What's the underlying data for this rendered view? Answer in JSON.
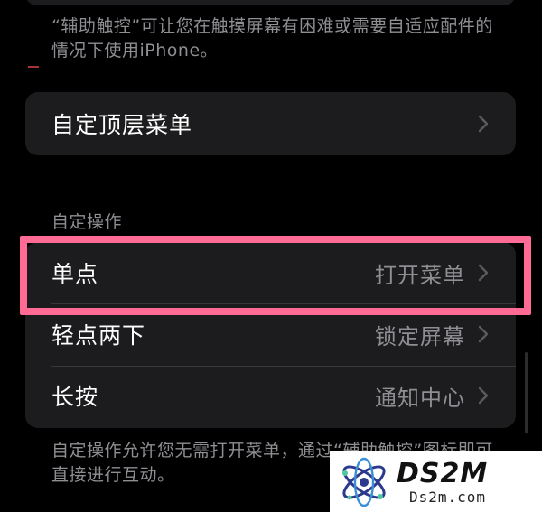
{
  "intro": {
    "description": "“辅助触控”可让您在触摸屏幕有困难或需要自适应配件的情况下使用iPhone。"
  },
  "top_menu": {
    "label": "自定顶层菜单"
  },
  "custom_actions": {
    "header": "自定操作",
    "rows": [
      {
        "label": "单点",
        "value": "打开菜单"
      },
      {
        "label": "轻点两下",
        "value": "锁定屏幕"
      },
      {
        "label": "长按",
        "value": "通知中心"
      }
    ],
    "footer": "自定操作允许您无需打开菜单，通过“辅助触控”图标即可直接进行互动。"
  },
  "watermark": {
    "brand": "DS2M",
    "url": "Ds2m.com"
  },
  "colors": {
    "background": "#000000",
    "card": "#1c1c1e",
    "secondary_text": "#8e8e93",
    "highlight": "#ff6b94"
  }
}
